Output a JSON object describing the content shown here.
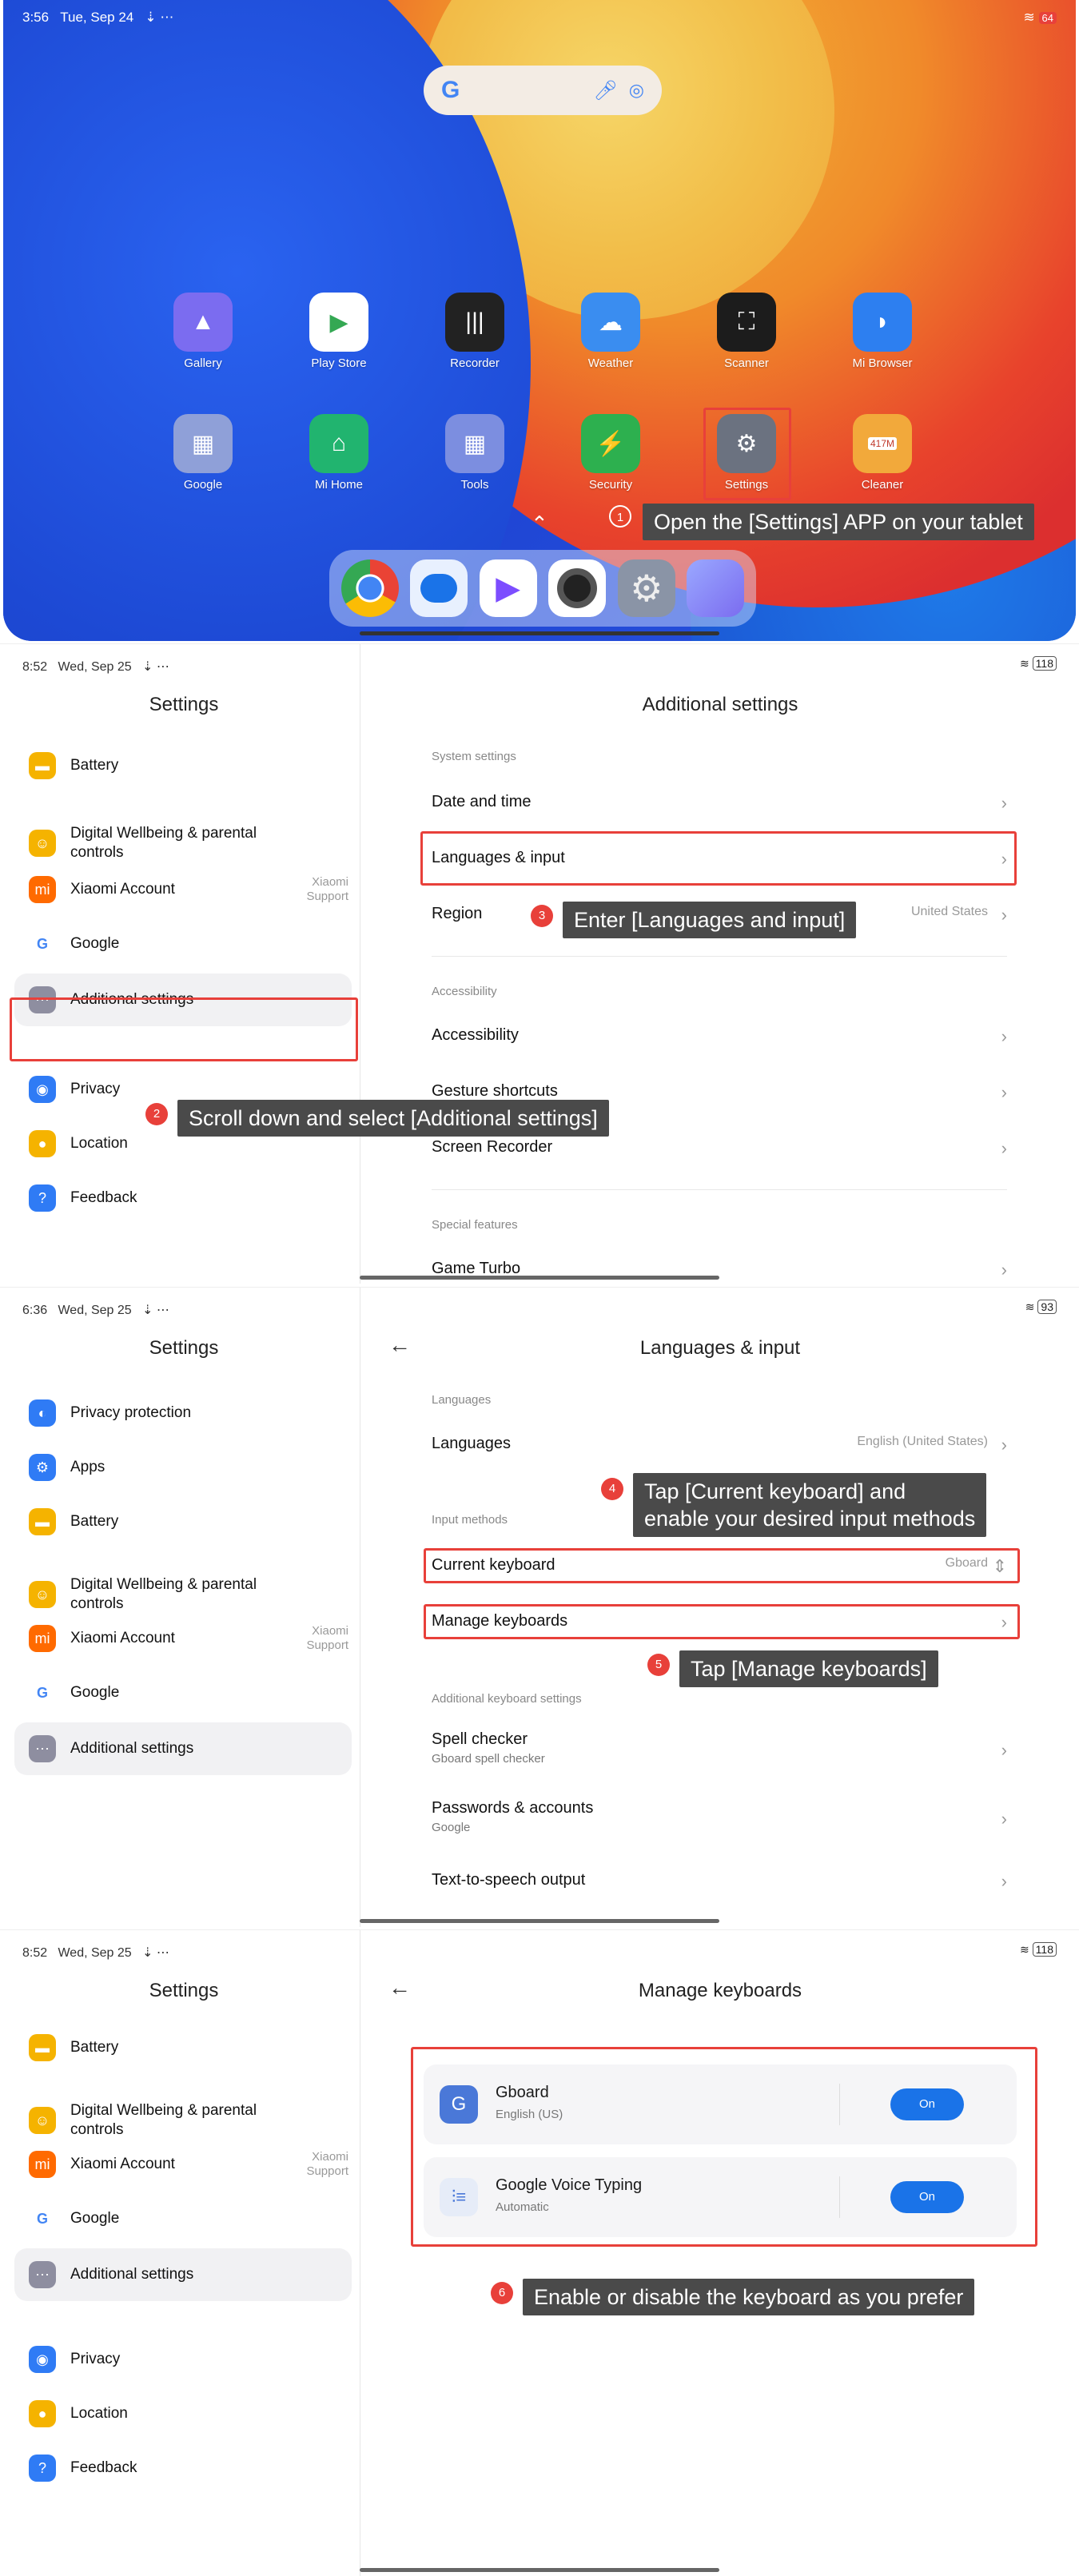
{
  "home": {
    "status_time": "3:56",
    "status_date": "Tue, Sep 24",
    "battery": "64",
    "apps_row1": [
      {
        "label": "Gallery",
        "color": "#7b6cf0"
      },
      {
        "label": "Play Store",
        "color": "#ffffff"
      },
      {
        "label": "Recorder",
        "color": "#222222"
      },
      {
        "label": "Weather",
        "color": "#3a8df0"
      },
      {
        "label": "Scanner",
        "color": "#1c1c1c"
      },
      {
        "label": "Mi Browser",
        "color": "#2d7ff0"
      }
    ],
    "apps_row2": [
      {
        "label": "Google",
        "color": "#8fa0d8"
      },
      {
        "label": "Mi Home",
        "color": "#21b46f"
      },
      {
        "label": "Tools",
        "color": "#7c8ee0"
      },
      {
        "label": "Security",
        "color": "#2db04f"
      },
      {
        "label": "Settings",
        "color": "#6b7280"
      },
      {
        "label": "Cleaner",
        "color": "#f2a93b"
      }
    ],
    "cleaner_badge": "417M",
    "callout_num": "1",
    "callout": "Open the [Settings] APP on your tablet"
  },
  "panel2": {
    "status_time": "8:52",
    "status_date": "Wed, Sep 25",
    "battery": "118",
    "left_title": "Settings",
    "right_title": "Additional settings",
    "left_items": [
      {
        "label": "Battery",
        "icon": "battery-icon",
        "color": "#f5b300",
        "glyph": "▬"
      },
      {
        "label": "Digital Wellbeing & parental controls",
        "icon": "wellbeing-icon",
        "color": "#f5b300",
        "glyph": "☺"
      },
      {
        "label": "Xiaomi Account",
        "icon": "mi-icon",
        "color": "#ff6a00",
        "glyph": "mi",
        "sub": "Xiaomi\nSupport"
      },
      {
        "label": "Google",
        "icon": "google-icon",
        "color": "#ffffff",
        "glyph": "G"
      },
      {
        "label": "Additional settings",
        "icon": "more-icon",
        "color": "#8e8ea0",
        "glyph": "⋯"
      },
      {
        "label": "Privacy",
        "icon": "privacy-icon",
        "color": "#2f7bf5",
        "glyph": "◉"
      },
      {
        "label": "Location",
        "icon": "location-icon",
        "color": "#f5b300",
        "glyph": "●"
      },
      {
        "label": "Feedback",
        "icon": "feedback-icon",
        "color": "#2f7bf5",
        "glyph": "?"
      }
    ],
    "sections": {
      "system": "System settings",
      "accessibility": "Accessibility",
      "special": "Special features"
    },
    "rows": {
      "date_time": "Date and time",
      "languages": "Languages & input",
      "region": "Region",
      "region_value": "United States",
      "accessibility": "Accessibility",
      "gesture": "Gesture shortcuts",
      "recorder": "Screen Recorder",
      "game": "Game Turbo"
    },
    "callout2_num": "2",
    "callout2": "Scroll down and select [Additional settings]",
    "callout3_num": "3",
    "callout3": "Enter [Languages and input]"
  },
  "panel3": {
    "status_time": "6:36",
    "status_date": "Wed, Sep 25",
    "battery": "93",
    "left_title": "Settings",
    "right_title": "Languages & input",
    "left_items": [
      {
        "label": "Privacy protection",
        "icon": "privacy-protection-icon",
        "color": "#2f7bf5",
        "glyph": "◐"
      },
      {
        "label": "Apps",
        "icon": "apps-icon",
        "color": "#2f7bf5",
        "glyph": "⚙"
      },
      {
        "label": "Battery",
        "icon": "battery-icon",
        "color": "#f5b300",
        "glyph": "▬"
      },
      {
        "label": "Digital Wellbeing & parental controls",
        "icon": "wellbeing-icon",
        "color": "#f5b300",
        "glyph": "☺"
      },
      {
        "label": "Xiaomi Account",
        "icon": "mi-icon",
        "color": "#ff6a00",
        "glyph": "mi",
        "sub": "Xiaomi\nSupport"
      },
      {
        "label": "Google",
        "icon": "google-icon",
        "color": "#ffffff",
        "glyph": "G"
      },
      {
        "label": "Additional settings",
        "icon": "more-icon",
        "color": "#8e8ea0",
        "glyph": "⋯"
      }
    ],
    "sections": {
      "languages": "Languages",
      "input": "Input methods",
      "additional": "Additional keyboard settings"
    },
    "rows": {
      "languages": "Languages",
      "languages_value": "English (United States)",
      "current": "Current keyboard",
      "current_value": "Gboard",
      "manage": "Manage keyboards",
      "spell": "Spell checker",
      "spell_sub": "Gboard spell checker",
      "passwords": "Passwords & accounts",
      "passwords_sub": "Google",
      "tts": "Text-to-speech output"
    },
    "callout4_num": "4",
    "callout4": "Tap [Current keyboard] and\nenable your desired input methods",
    "callout5_num": "5",
    "callout5": "Tap [Manage keyboards]"
  },
  "panel4": {
    "status_time": "8:52",
    "status_date": "Wed, Sep 25",
    "battery": "118",
    "left_title": "Settings",
    "right_title": "Manage keyboards",
    "left_items": [
      {
        "label": "Battery",
        "icon": "battery-icon",
        "color": "#f5b300",
        "glyph": "▬"
      },
      {
        "label": "Digital Wellbeing & parental controls",
        "icon": "wellbeing-icon",
        "color": "#f5b300",
        "glyph": "☺"
      },
      {
        "label": "Xiaomi Account",
        "icon": "mi-icon",
        "color": "#ff6a00",
        "glyph": "mi",
        "sub": "Xiaomi\nSupport"
      },
      {
        "label": "Google",
        "icon": "google-icon",
        "color": "#ffffff",
        "glyph": "G"
      },
      {
        "label": "Additional settings",
        "icon": "more-icon",
        "color": "#8e8ea0",
        "glyph": "⋯"
      },
      {
        "label": "Privacy",
        "icon": "privacy-icon",
        "color": "#2f7bf5",
        "glyph": "◉"
      },
      {
        "label": "Location",
        "icon": "location-icon",
        "color": "#f5b300",
        "glyph": "●"
      },
      {
        "label": "Feedback",
        "icon": "feedback-icon",
        "color": "#2f7bf5",
        "glyph": "?"
      }
    ],
    "keyboards": [
      {
        "name": "Gboard",
        "sub": "English (US)",
        "toggle": "On"
      },
      {
        "name": "Google Voice Typing",
        "sub": "Automatic",
        "toggle": "On"
      }
    ],
    "callout6_num": "6",
    "callout6": "Enable or disable the keyboard as you prefer"
  }
}
